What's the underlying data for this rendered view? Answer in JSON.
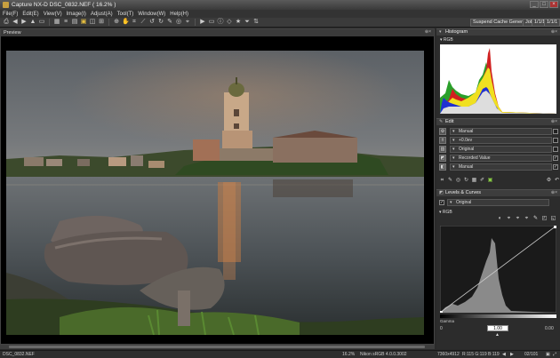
{
  "window": {
    "title": "Capture NX-D    DSC_0832.NEF ( 16.2% )",
    "min": "_",
    "max": "□",
    "close": "×"
  },
  "menu": [
    "File(F)",
    "Edit(E)",
    "View(V)",
    "Image(I)",
    "Adjust(A)",
    "Tool(T)",
    "Window(W)",
    "Help(H)"
  ],
  "workspace": {
    "name": "Suspend Cache Generation",
    "b1": "Job",
    "b2": "1/1/1",
    "b3": "1/1/1"
  },
  "preview": {
    "label": "Preview",
    "pin": "⊕×"
  },
  "histogram": {
    "label": "Histogram",
    "channel": "RGB",
    "ctrl": "⊕×"
  },
  "edit": {
    "label": "Edit",
    "ctrl": "⊕×",
    "rows": [
      {
        "icon": "⚙",
        "value": "Manual",
        "checked": ""
      },
      {
        "icon": "±",
        "value": "+0.0ev",
        "checked": ""
      },
      {
        "icon": "▥",
        "value": "Original",
        "checked": ""
      },
      {
        "icon": "◩",
        "value": "Recorded Value",
        "checked": "✓"
      },
      {
        "icon": "◧",
        "value": "Manual",
        "checked": "✓"
      }
    ]
  },
  "levels": {
    "label": "Levels & Curves",
    "ctrl": "⊕×",
    "preset": "Original",
    "channel": "RGB",
    "gamma_label": "Gamma",
    "gamma_value": "1.00",
    "min_val": "0",
    "max_val": "0.00"
  },
  "status": {
    "file": "DSC_0832.NEF",
    "zoom": "16.2%",
    "profile": "Nikon sRGB 4.0.0.3002",
    "size": "7360x4912",
    "pixel": "R:115 G:119 B:119",
    "page": "02/101"
  },
  "colors": {
    "accent": "#3d6fb0",
    "panel": "#2c2c2c"
  }
}
